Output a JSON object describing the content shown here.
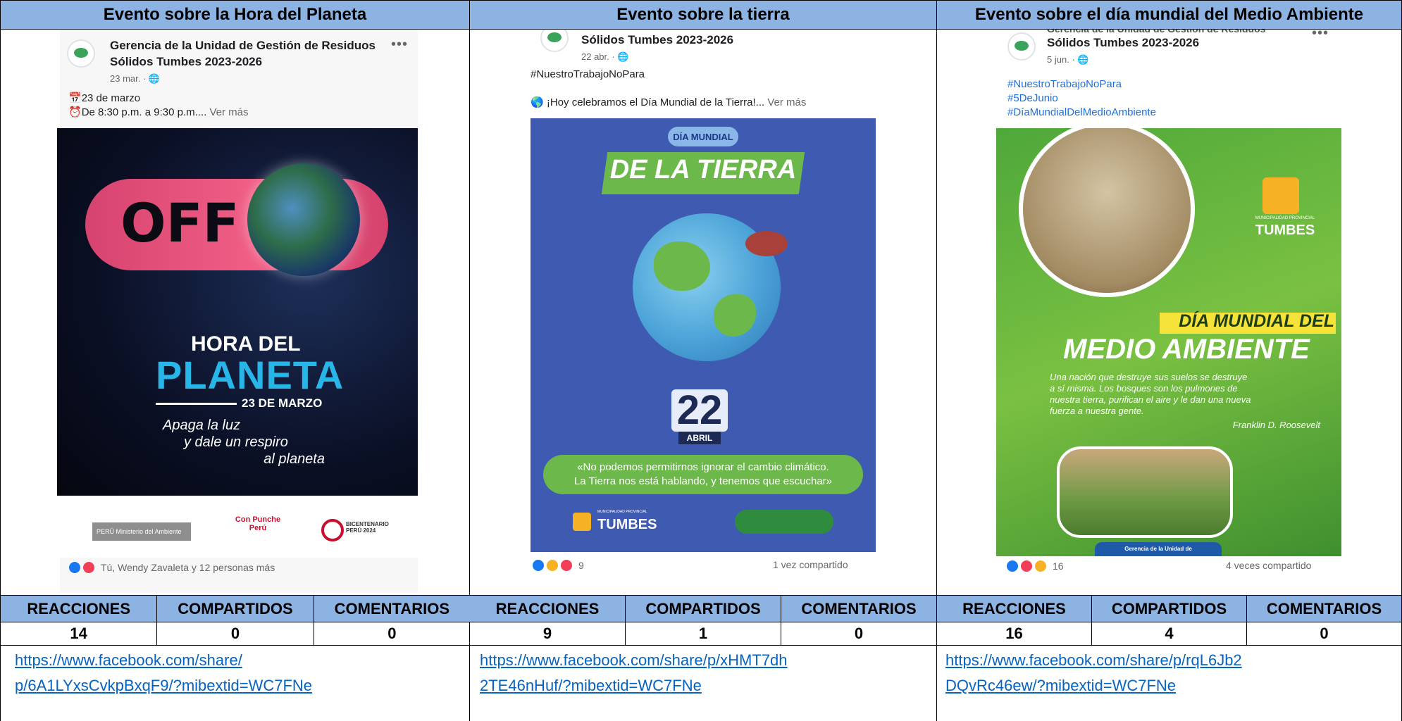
{
  "columns": [
    {
      "header": "Evento sobre la Hora del Planeta",
      "post": {
        "page_name_line1": "Gerencia de la Unidad de Gestión de Residuos",
        "page_name_line2": "Sólidos Tumbes 2023-2026",
        "date": "23 mar. · ",
        "text_line1": "23 de marzo",
        "text_line2": "De 8:30 p.m. a 9:30 p.m....",
        "more": "Ver más",
        "image": {
          "big_word": "OFF",
          "title1": "HORA DEL",
          "title2": "PLANETA",
          "date": "23 DE MARZO",
          "line1": "Apaga la luz",
          "line2": "y dale un respiro",
          "line3": "al planeta",
          "logo1": "PERÚ Ministerio del Ambiente",
          "logo2": "Con Punche Perú",
          "logo3": "BICENTENARIO PERÚ 2024"
        },
        "reactions_text": "Tú, Wendy Zavaleta y 12 personas más"
      },
      "table": {
        "headers": [
          "REACCIONES",
          "COMPARTIDOS",
          "COMENTARIOS"
        ],
        "values": [
          "14",
          "0",
          "0"
        ]
      },
      "link_line1": "https://www.facebook.com/share/",
      "link_line2": "p/6A1LYxsCvkpBxqF9/?mibextid=WC7FNe"
    },
    {
      "header": "Evento sobre la tierra",
      "post": {
        "page_name_line2": "Sólidos Tumbes 2023-2026",
        "date": "22 abr. · ",
        "hashtag": "#NuestroTrabajoNoPara",
        "text_line1": "¡Hoy celebramos el Día Mundial de la Tierra!...",
        "more": "Ver más",
        "image": {
          "badge": "DÍA MUNDIAL",
          "title": "DE LA TIERRA",
          "day": "22",
          "month": "ABRIL",
          "quote_line1": "«No podemos permitirnos ignorar el cambio climático.",
          "quote_line2": "La Tierra nos está hablando, y tenemos que escuchar»",
          "logo_small": "MUNICIPALIDAD PROVINCIAL",
          "logo_big": "TUMBES"
        },
        "reactions_count": "9",
        "shares_text": "1 vez compartido"
      },
      "table": {
        "headers": [
          "REACCIONES",
          "COMPARTIDOS",
          "COMENTARIOS"
        ],
        "values": [
          "9",
          "1",
          "0"
        ]
      },
      "link_line1": "https://www.facebook.com/share/p/xHMT7dh",
      "link_line2": "2TE46nHuf/?mibextid=WC7FNe"
    },
    {
      "header": "Evento sobre el día mundial del Medio Ambiente",
      "post": {
        "page_name_line1": "Gerencia de la Unidad de Gestión de Residuos",
        "page_name_line2": "Sólidos Tumbes 2023-2026",
        "date": "5 jun. · ",
        "hashtag1": "#NuestroTrabajoNoPara",
        "hashtag2": "#5DeJunio",
        "hashtag3": "#DíaMundialDelMedioAmbiente",
        "image": {
          "muni_small": "MUNICIPALIDAD PROVINCIAL",
          "muni_big": "TUMBES",
          "title1": "DÍA MUNDIAL DEL",
          "title2": "MEDIO AMBIENTE",
          "quote_line1": "Una nación que destruye sus suelos se destruye",
          "quote_line2": "a sí misma. Los bosques son los pulmones de",
          "quote_line3": "nuestra tierra, purifican el aire y le dan una nueva",
          "quote_line4": "fuerza a nuestra gente.",
          "author": "Franklin D. Roosevelt",
          "footer": "Gerencia de la Unidad de"
        },
        "reactions_count": "16",
        "shares_text": "4 veces compartido"
      },
      "table": {
        "headers": [
          "REACCIONES",
          "COMPARTIDOS",
          "COMENTARIOS"
        ],
        "values": [
          "16",
          "4",
          "0"
        ]
      },
      "link_line1": "https://www.facebook.com/share/p/rqL6Jb2",
      "link_line2": "DQvRc46ew/?mibextid=WC7FNe"
    }
  ]
}
